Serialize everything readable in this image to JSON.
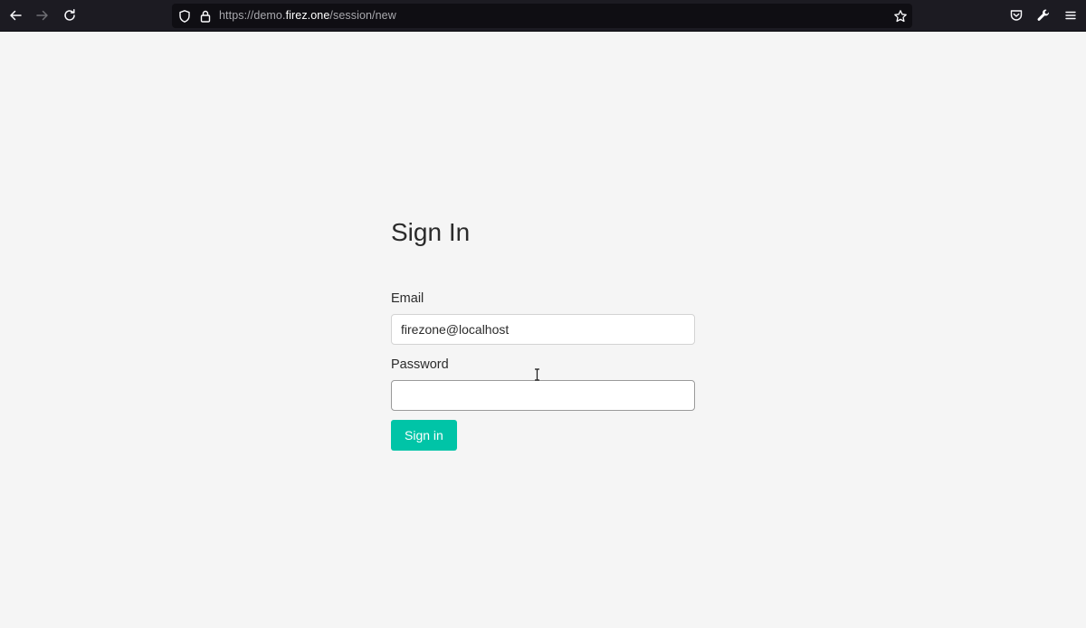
{
  "browser": {
    "url_prefix": "https://demo.",
    "url_host": "firez.one",
    "url_path": "/session/new",
    "toolbar_bg": "#1c1b22",
    "urlbar_bg": "#0f0e13"
  },
  "page": {
    "background": "#f5f5f5",
    "title": "Sign In",
    "email_label": "Email",
    "email_value": "firezone@localhost",
    "password_label": "Password",
    "password_value": "",
    "submit_label": "Sign in",
    "accent": "#00c4a7"
  },
  "icons": {
    "back": "arrow-left-icon",
    "forward": "arrow-right-icon",
    "reload": "reload-icon",
    "shield": "shield-icon",
    "lock": "lock-icon",
    "bookmark": "star-icon",
    "pocket": "pocket-icon",
    "devtools": "wrench-icon",
    "menu": "hamburger-menu-icon",
    "cursor": "text-cursor-icon"
  }
}
